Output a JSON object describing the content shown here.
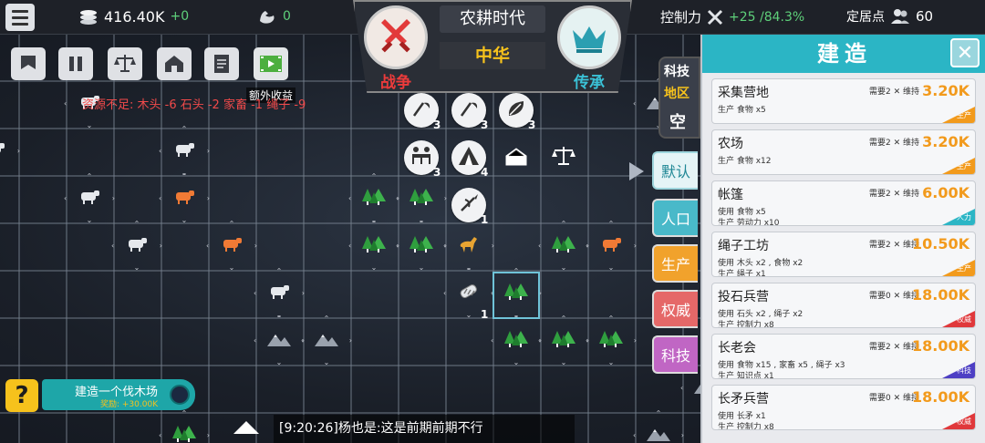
{
  "topbar": {
    "coins": "416.40K",
    "coins_delta": "+0",
    "strength": "0",
    "control_label": "控制力",
    "control_value": "+25 /84.3%",
    "settlement_label": "定居点",
    "settlement_value": "60"
  },
  "emblem": {
    "era": "农耕时代",
    "civ": "中华",
    "war_label": "战争",
    "inherit_label": "传承"
  },
  "toolbar": {
    "bonus_tooltip": "额外收益",
    "warning": "资源不足: 木头 -6  石头 -2  家畜 -1  绳子 -9"
  },
  "quest": {
    "title": "建造一个伐木场",
    "reward": "奖励: +30.00K",
    "help_symbol": "?"
  },
  "chat": {
    "message": "[9:20:26]杨也是:这是前期前期不行"
  },
  "region": {
    "tech_label": "科技",
    "region_label": "地区",
    "empty_label": "空"
  },
  "side_tabs": {
    "default": "默认",
    "population": "人口",
    "production": "生产",
    "authority": "权威",
    "tech": "科技"
  },
  "map": {
    "building_counts": [
      "3",
      "3",
      "3",
      "3",
      "4",
      "1",
      "1"
    ]
  },
  "panel": {
    "title": "建造",
    "close_symbol": "✕",
    "upkeep_label": "维持",
    "cards": [
      {
        "name": "采集营地",
        "need": "需要2",
        "cost": "3.20K",
        "line1": "生产  食物 x5",
        "line2": "",
        "tag": "生产"
      },
      {
        "name": "农场",
        "need": "需要2",
        "cost": "3.20K",
        "line1": "生产  食物 x12",
        "line2": "",
        "tag": "生产"
      },
      {
        "name": "帐篷",
        "need": "需要2",
        "cost": "6.00K",
        "line1": "使用  食物 x5",
        "line2": "生产  劳动力 x10",
        "tag": "人力"
      },
      {
        "name": "绳子工坊",
        "need": "需要2",
        "cost": "10.50K",
        "line1": "使用  木头 x2 , 食物 x2",
        "line2": "生产  绳子 x1",
        "tag": "生产"
      },
      {
        "name": "投石兵营",
        "need": "需要0",
        "cost": "18.00K",
        "line1": "使用  石头 x2 , 绳子 x2",
        "line2": "生产  控制力 x8",
        "tag": "权威"
      },
      {
        "name": "长老会",
        "need": "需要2",
        "cost": "18.00K",
        "line1": "使用  食物 x15 , 家畜 x5 , 绳子 x3",
        "line2": "生产  知识点 x1",
        "tag": "科技"
      },
      {
        "name": "长矛兵营",
        "need": "需要0",
        "cost": "18.00K",
        "line1": "使用  长矛 x1",
        "line2": "生产  控制力 x8",
        "tag": "权威"
      }
    ]
  },
  "colors": {
    "accent_teal": "#2bb5c5",
    "cost_orange": "#f29a1c",
    "warning_red": "#f14a4a",
    "civ_gold": "#f6c21c"
  }
}
